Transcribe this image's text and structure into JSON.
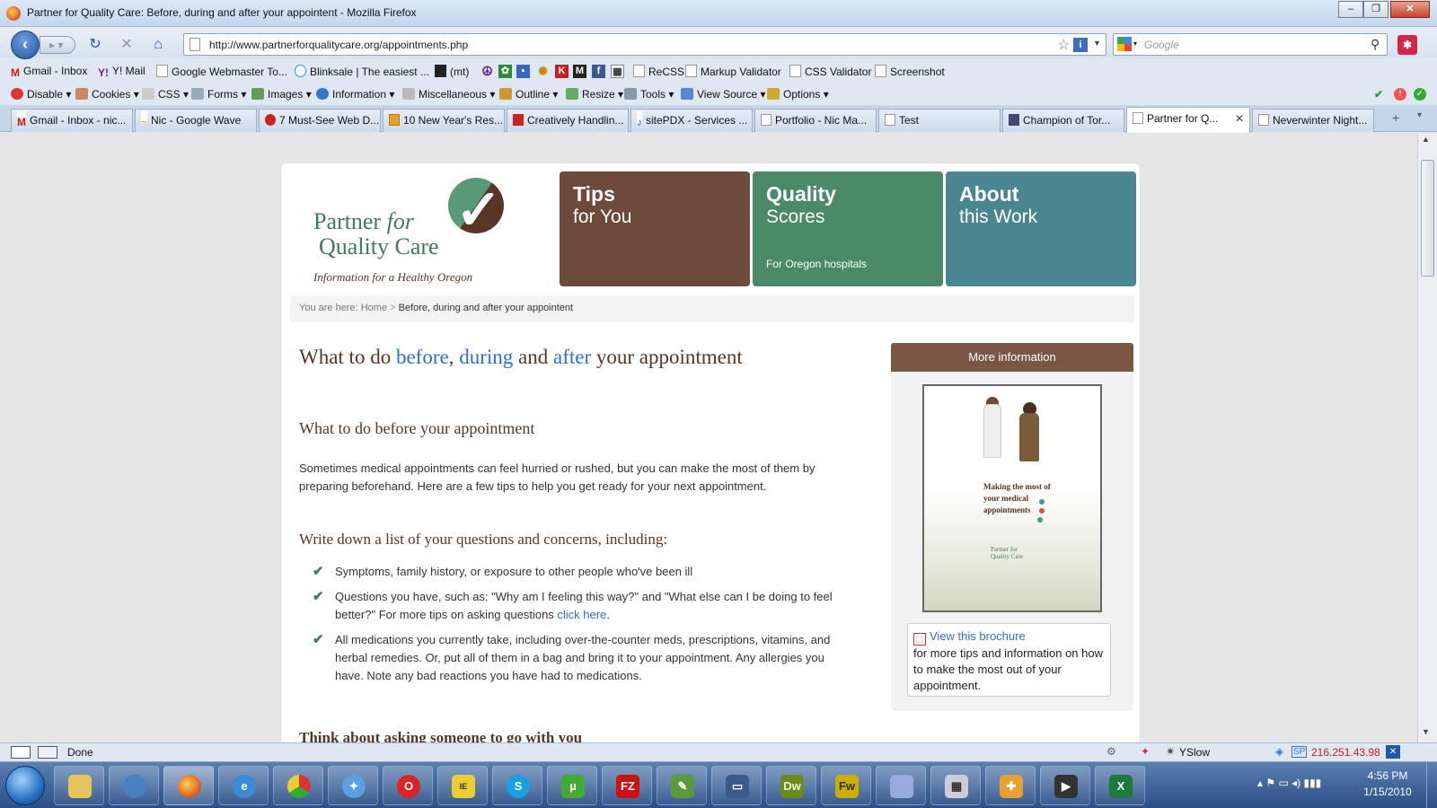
{
  "window": {
    "title": "Partner for Quality Care: Before, during and after your appointent - Mozilla Firefox"
  },
  "navbar": {
    "url": "http://www.partnerforqualitycare.org/appointments.php",
    "search_placeholder": "Google"
  },
  "bookmarks": [
    "Gmail - Inbox",
    "Y! Mail",
    "Google Webmaster To...",
    "Blinksale | The easiest ...",
    "(mt)",
    "ReCSS",
    "Markup Validator",
    "CSS Validator",
    "Screenshot"
  ],
  "devtoolbar": [
    "Disable",
    "Cookies",
    "CSS",
    "Forms",
    "Images",
    "Information",
    "Miscellaneous",
    "Outline",
    "Resize",
    "Tools",
    "View Source",
    "Options"
  ],
  "tabs": [
    "Gmail - Inbox - nic...",
    "Nic - Google Wave",
    "7 Must-See Web D...",
    "10 New Year's Res...",
    "Creatively Handlin...",
    "sitePDX - Services ...",
    "Portfolio - Nic Ma...",
    "Test",
    "Champion of Tor...",
    "Partner for Q...",
    "Neverwinter Night..."
  ],
  "site": {
    "logo_line1": "Partner",
    "logo_for": "for",
    "logo_line2": "Quality Care",
    "logo_tagline": "Information for a Healthy Oregon",
    "nav": [
      {
        "big": "Tips",
        "small": "for You",
        "sub": "",
        "color": "#6e4a3a"
      },
      {
        "big": "Quality",
        "small": "Scores",
        "sub": "For Oregon hospitals",
        "color": "#4a8a66"
      },
      {
        "big": "About",
        "small": "this Work",
        "sub": "",
        "color": "#4a8592"
      }
    ],
    "breadcrumb": {
      "prefix": "You are here:",
      "home": "Home",
      "sep": ">",
      "current": "Before, during and after your appointent"
    },
    "heading": {
      "a": "What to do ",
      "before": "before",
      "c1": ", ",
      "during": "during",
      "c2": " and ",
      "after": "after",
      "d": " your appointment"
    },
    "section1": "What to do before your appointment",
    "intro": "Sometimes medical appointments can feel hurried or rushed, but you can make the most of them by preparing beforehand. Here are a few tips to help you get ready for your next appointment.",
    "list_heading": "Write down a list of your questions and concerns, including:",
    "items": [
      "Symptoms, family history, or exposure to other people who've been ill",
      "Questions you have, such as: \"Why am I feeling this way?\" and \"What else can I be doing to feel better?\" For more tips on asking questions ",
      "All medications you currently take, including over-the-counter meds, prescriptions, vitamins, and herbal remedies. Or, put all of them in a bag and bring it to your appointment. Any allergies you have. Note any bad reactions you have had to medications."
    ],
    "click_here": "click here",
    "period": ".",
    "next_heading": "Think about asking someone to go with you",
    "sidebar": {
      "title": "More information",
      "brochure_text": "Making the most of your medical appointments",
      "brochure_logo": "Partner for Quality Care",
      "link": "View this brochure",
      "desc": "for more tips and information on how to make the most out of your appointment."
    }
  },
  "status": {
    "text": "Done",
    "yslow": "YSlow",
    "ip": "216.251.43.98"
  },
  "clock": {
    "time": "4:56 PM",
    "date": "1/15/2010"
  }
}
